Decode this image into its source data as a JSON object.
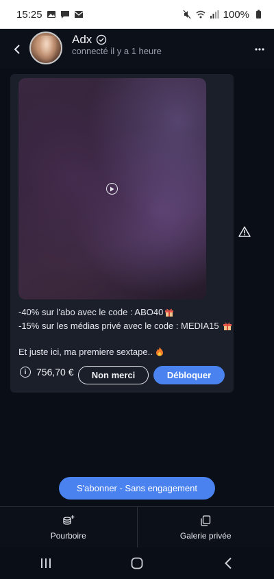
{
  "status_bar": {
    "time": "15:25",
    "battery": "100%",
    "left_icons": [
      "image-icon",
      "chat-icon",
      "mail-icon"
    ],
    "right_icons": [
      "mute-icon",
      "wifi-icon",
      "signal-icon",
      "battery-icon"
    ]
  },
  "header": {
    "name": "Adx",
    "presence": "connecté il y a 1 heure",
    "icons": [
      "back-arrow-icon",
      "verified-badge-icon",
      "more-options-icon"
    ]
  },
  "message": {
    "line1": "-40% sur l'abo avec le code : ABO40",
    "line2": "-15% sur les médias privé avec le code : MEDIA15",
    "line3": "Et juste ici, ma premiere sextape..",
    "price": "756,70 €",
    "decline_label": "Non merci",
    "unlock_label": "Débloquer",
    "icons": [
      "play-icon",
      "gift-icon",
      "fire-icon",
      "info-icon",
      "warning-icon"
    ]
  },
  "subscribe": {
    "label": "S'abonner - Sans engagement"
  },
  "tabbar": {
    "tabs": [
      {
        "label": "Pourboire",
        "icon": "tip-coins-icon"
      },
      {
        "label": "Galerie privée",
        "icon": "gallery-copy-icon"
      }
    ]
  },
  "navbar": {
    "buttons": [
      "recents-icon",
      "home-icon",
      "back-icon"
    ]
  },
  "colors": {
    "background": "#0a0e17",
    "card": "#1a1f29",
    "accent": "#4a82f0",
    "text": "#e6e8ee",
    "muted": "#9aa0ad"
  }
}
